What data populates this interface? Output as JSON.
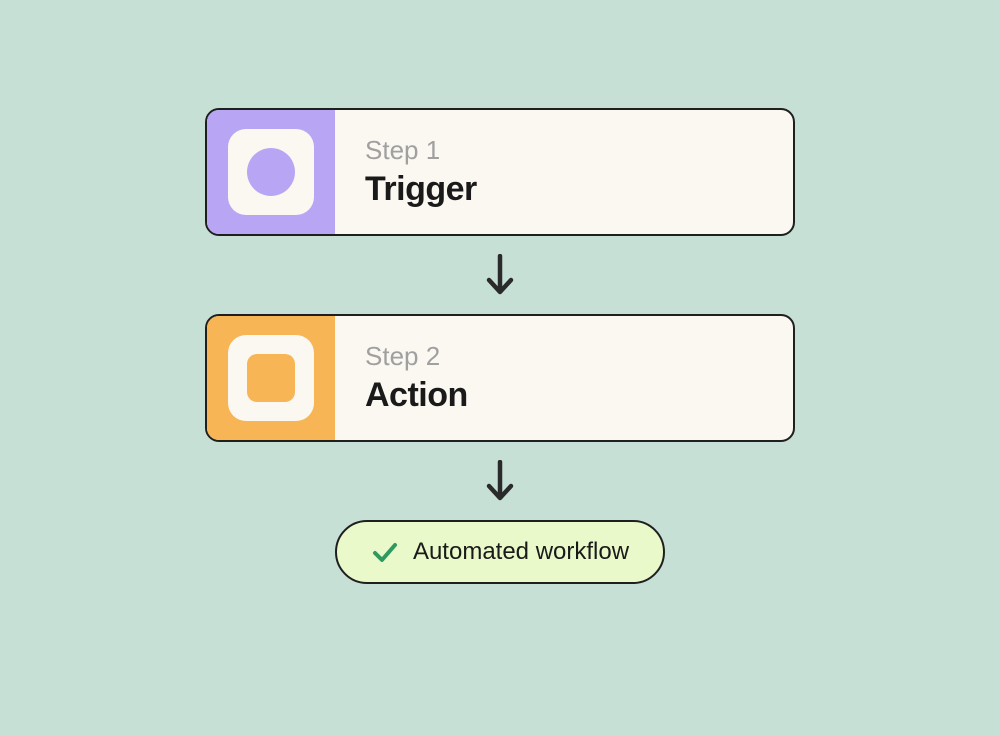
{
  "steps": [
    {
      "label": "Step 1",
      "title": "Trigger"
    },
    {
      "label": "Step 2",
      "title": "Action"
    }
  ],
  "result": {
    "text": "Automated workflow"
  }
}
